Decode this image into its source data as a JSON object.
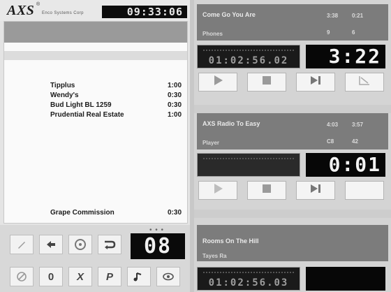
{
  "app": {
    "logo": "AXS",
    "logo_reg": "®",
    "logo_sub": "Enco Systems Corp",
    "clock": "09:33:06"
  },
  "playlist": {
    "items": [
      {
        "title": "Tipplus",
        "duration": "1:00"
      },
      {
        "title": "Wendy's",
        "duration": "0:30"
      },
      {
        "title": "Bud Light BL 1259",
        "duration": "0:30"
      },
      {
        "title": "Prudential Real Estate",
        "duration": "1:00"
      },
      {
        "title": "Grape Commission",
        "duration": "0:30"
      }
    ]
  },
  "controls": {
    "counter": "08",
    "counter_dots": "• • •",
    "buttons": [
      {
        "name": "pencil-icon",
        "label": ""
      },
      {
        "name": "arrow-icon",
        "label": ""
      },
      {
        "name": "disc-icon",
        "label": ""
      },
      {
        "name": "return-icon",
        "label": ""
      },
      {
        "name": "no-icon",
        "label": ""
      },
      {
        "name": "info-icon",
        "label": "0"
      },
      {
        "name": "x-icon",
        "label": "X"
      },
      {
        "name": "p-icon",
        "label": "P"
      },
      {
        "name": "note-icon",
        "label": ""
      },
      {
        "name": "eye-icon",
        "label": ""
      }
    ]
  },
  "players": [
    {
      "title": "Come Go You Are",
      "artist": "Phones",
      "m1": "3:38",
      "m2": "0:21",
      "m3": "9",
      "m4": "6",
      "meter": "01:02:56.02",
      "time": "3:22"
    },
    {
      "title": "AXS Radio To Easy",
      "artist": "Player",
      "m1": "4:03",
      "m2": "3:57",
      "m3": "C8",
      "m4": "42",
      "meter": "",
      "time": "0:01"
    },
    {
      "title": "Rooms On The Hill",
      "artist": "Tayes Ra",
      "m1": "",
      "m2": "",
      "m3": "",
      "m4": "",
      "meter": "01:02:56.03",
      "time": ""
    }
  ],
  "colors": {
    "header": "#7c7c7c",
    "display": "#070707",
    "panel": "#d4d4d4"
  }
}
